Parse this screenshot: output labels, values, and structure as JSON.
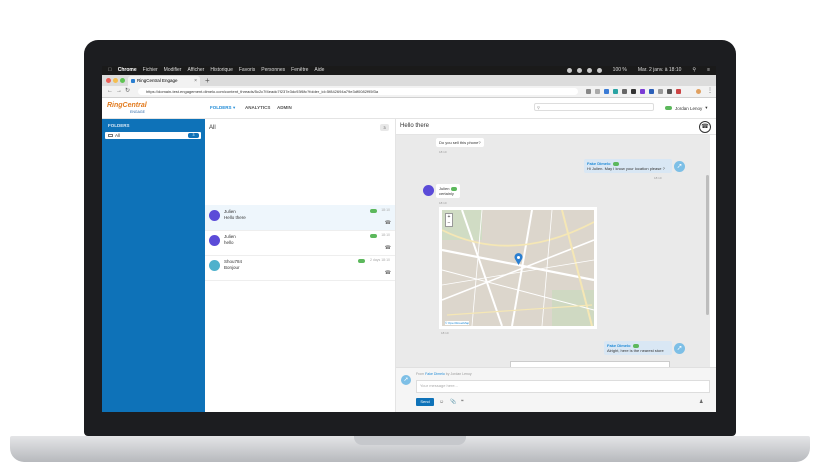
{
  "menubar": {
    "app": "Chrome",
    "items": [
      "Fichier",
      "Modifier",
      "Afficher",
      "Historique",
      "Favoris",
      "Personnes",
      "Fenêtre",
      "Aide"
    ],
    "battery": "100 %",
    "clock": "Mar. 2 janv. à 18:10"
  },
  "browser": {
    "tab_title": "RingCentral Engage",
    "url": "https://domain-test.engagement.dimelo.com/content_threads/5c2c7f4eadc7f237e3dc93f6fc?folder_id=5f842694a79e3df0082f95f3a"
  },
  "app": {
    "logo": "RingCentral",
    "logo_sub": "ENGAGE",
    "nav": {
      "folders": "FOLDERS",
      "analytics": "ANALYTICS",
      "admin": "ADMIN"
    },
    "user_name": "Jordan Lenoy"
  },
  "sidebar": {
    "title": "FOLDERS",
    "items": [
      {
        "label": "All",
        "count": "3"
      }
    ]
  },
  "threads": {
    "header": "All",
    "count": "3",
    "items": [
      {
        "name": "Julien",
        "preview": "Hello there",
        "time": "18:10",
        "color": "#5b4bd8"
      },
      {
        "name": "Julien",
        "preview": "hello",
        "time": "18:10",
        "color": "#5b4bd8"
      },
      {
        "name": "Shou784",
        "preview": "Bonjour",
        "time": "2 days 18:10",
        "color": "#4fb1cc"
      }
    ]
  },
  "conversation": {
    "title": "Hello there",
    "messages": {
      "m1": {
        "text": "Do you sell this phone?",
        "time": "18:10"
      },
      "m2": {
        "author": "Fake Dimelo",
        "text": "Hi Julien. May I know your location please ?",
        "time": "18:10"
      },
      "m3": {
        "author": "Julien",
        "text": "certainly",
        "time": "18:10"
      },
      "map_attribution": "© OpenStreetMap",
      "m4_time": "18:10",
      "m5": {
        "author": "Fake Dimelo",
        "text": "Alright, here is the nearest store",
        "time": "18:10"
      }
    },
    "composer": {
      "from_prefix": "From",
      "from_account": "Fake Dimelo",
      "from_by": "by Jordan Lenoy",
      "placeholder": "Your message here...",
      "send": "Send"
    }
  }
}
